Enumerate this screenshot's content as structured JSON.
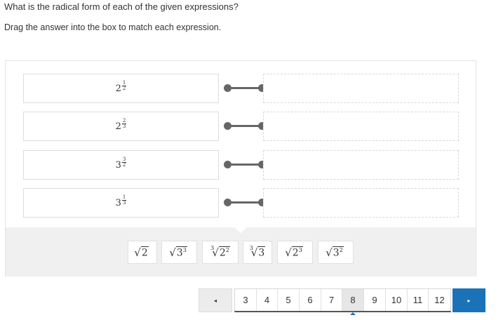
{
  "question": "What is the radical form of each of the given expressions?",
  "instruction": "Drag the answer into the box to match each expression.",
  "expressions": [
    {
      "base": "2",
      "num": "1",
      "den": "2"
    },
    {
      "base": "2",
      "num": "2",
      "den": "3"
    },
    {
      "base": "3",
      "num": "3",
      "den": "2"
    },
    {
      "base": "3",
      "num": "1",
      "den": "3"
    }
  ],
  "answers": [
    {
      "index": "",
      "radicand": "2",
      "exp": ""
    },
    {
      "index": "",
      "radicand": "3",
      "exp": "3"
    },
    {
      "index": "3",
      "radicand": "2",
      "exp": "2"
    },
    {
      "index": "3",
      "radicand": "3",
      "exp": ""
    },
    {
      "index": "",
      "radicand": "2",
      "exp": "3"
    },
    {
      "index": "",
      "radicand": "3",
      "exp": "2"
    }
  ],
  "radical_symbol": "√",
  "pagination": {
    "prev_icon": "◂",
    "next_icon": "▸",
    "pages": [
      "3",
      "4",
      "5",
      "6",
      "7",
      "8",
      "9",
      "10",
      "11",
      "12"
    ],
    "current": "8"
  }
}
